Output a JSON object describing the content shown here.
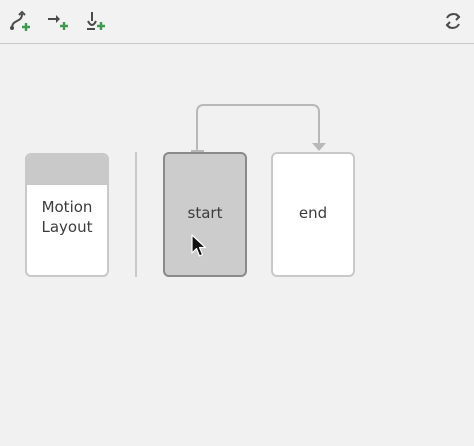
{
  "toolbar": {
    "buttons": [
      {
        "icon": "create-transition-icon"
      },
      {
        "icon": "create-click-handler-icon"
      },
      {
        "icon": "create-constraint-set-icon"
      }
    ],
    "right_icon": "cycle-icon",
    "accent": "#3c9b4e"
  },
  "canvas": {
    "base_layout": {
      "label": "Motion\nLayout"
    },
    "constraint_sets": [
      {
        "label": "start",
        "selected": true
      },
      {
        "label": "end",
        "selected": false
      }
    ],
    "transition": {
      "from": "start",
      "to": "end"
    }
  },
  "colors": {
    "background": "#f1f1f1",
    "card_border": "#c9c9c9",
    "selected_fill": "#cccccc",
    "selected_border": "#8a8a8a",
    "text": "#3c3c3c",
    "transition_line": "#b8b8b8"
  }
}
